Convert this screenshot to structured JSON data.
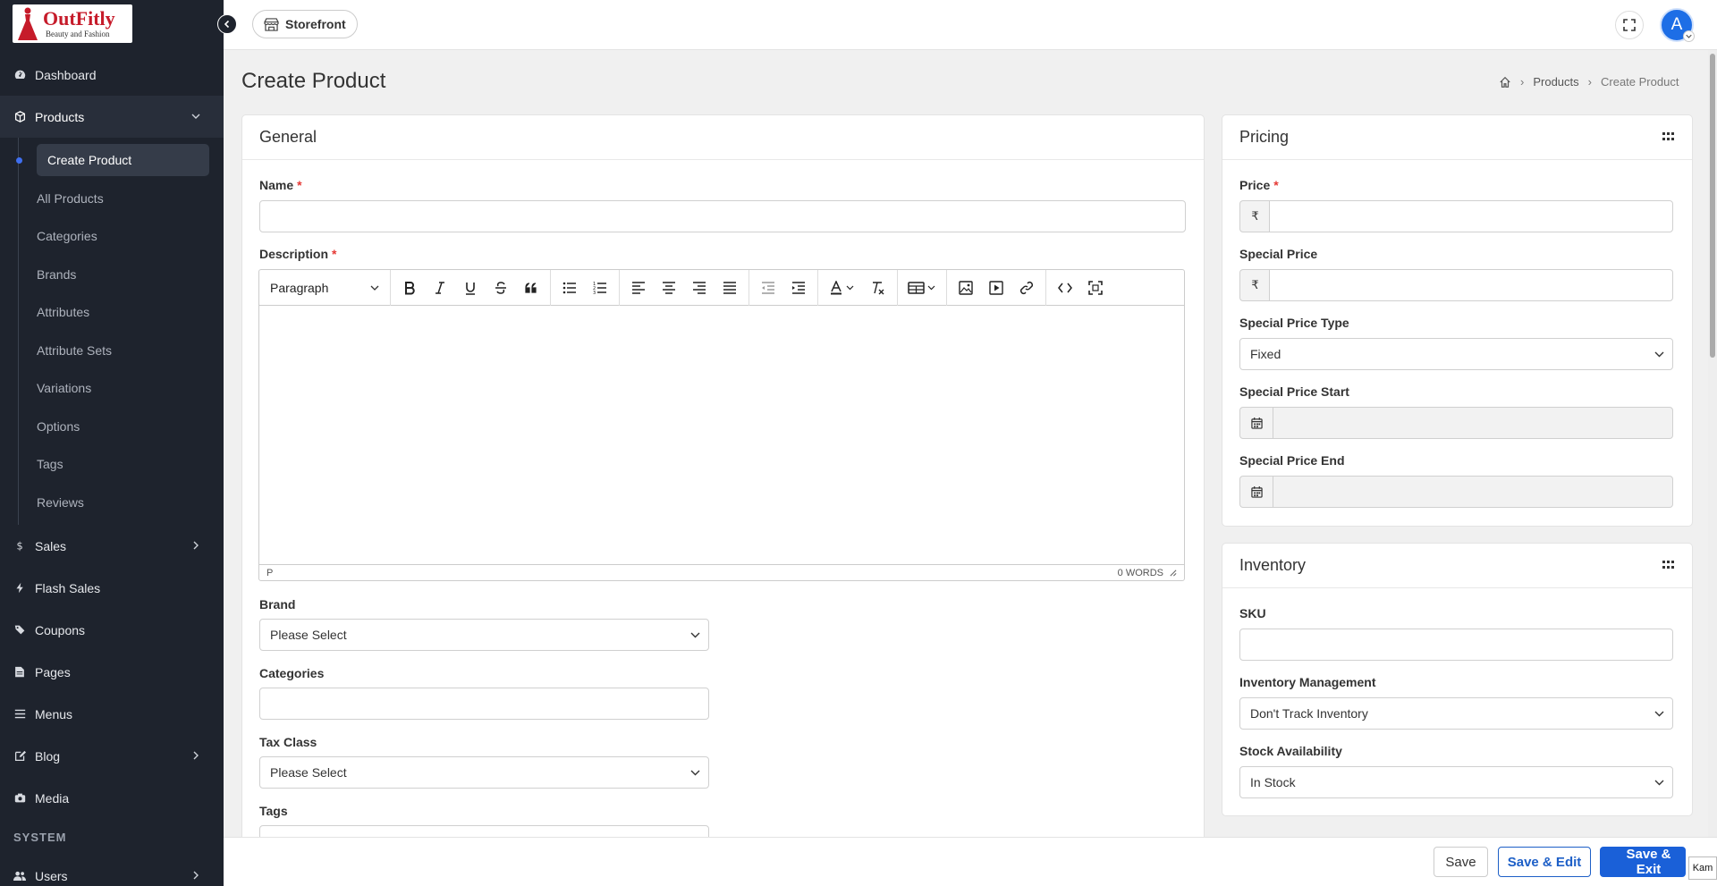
{
  "logo": {
    "brand": "OutFitly",
    "tagline": "Beauty and Fashion"
  },
  "sidebar": {
    "items": [
      {
        "label": "Dashboard"
      },
      {
        "label": "Products"
      },
      {
        "label": "Sales"
      },
      {
        "label": "Flash Sales"
      },
      {
        "label": "Coupons"
      },
      {
        "label": "Pages"
      },
      {
        "label": "Menus"
      },
      {
        "label": "Blog"
      },
      {
        "label": "Media"
      }
    ],
    "products_sub": [
      {
        "label": "Create Product"
      },
      {
        "label": "All Products"
      },
      {
        "label": "Categories"
      },
      {
        "label": "Brands"
      },
      {
        "label": "Attributes"
      },
      {
        "label": "Attribute Sets"
      },
      {
        "label": "Variations"
      },
      {
        "label": "Options"
      },
      {
        "label": "Tags"
      },
      {
        "label": "Reviews"
      }
    ],
    "section_system": "SYSTEM",
    "users": "Users"
  },
  "topbar": {
    "storefront": "Storefront",
    "avatar_initial": "A"
  },
  "page": {
    "title": "Create Product"
  },
  "breadcrumb": {
    "products": "Products",
    "current": "Create Product"
  },
  "general": {
    "title": "General",
    "name_label": "Name",
    "required_mark": "*",
    "description_label": "Description",
    "editor": {
      "format": "Paragraph",
      "status_path": "P",
      "word_count": "0 WORDS"
    },
    "brand_label": "Brand",
    "brand_value": "Please Select",
    "categories_label": "Categories",
    "tax_class_label": "Tax Class",
    "tax_class_value": "Please Select",
    "tags_label": "Tags"
  },
  "pricing": {
    "title": "Pricing",
    "currency": "₹",
    "price_label": "Price",
    "special_price_label": "Special Price",
    "special_price_type_label": "Special Price Type",
    "special_price_type_value": "Fixed",
    "special_price_start_label": "Special Price Start",
    "special_price_end_label": "Special Price End"
  },
  "inventory": {
    "title": "Inventory",
    "sku_label": "SKU",
    "management_label": "Inventory Management",
    "management_value": "Don't Track Inventory",
    "stock_label": "Stock Availability",
    "stock_value": "In Stock"
  },
  "footer": {
    "save": "Save",
    "save_edit": "Save & Edit",
    "save_exit": "Save & Exit",
    "corner": "Kam"
  }
}
